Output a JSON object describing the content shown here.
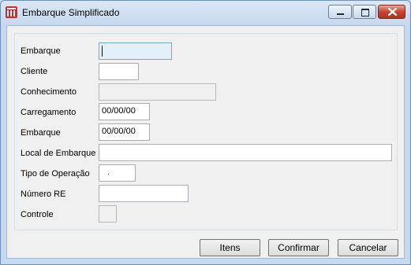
{
  "window": {
    "title": "Embarque Simplificado"
  },
  "form": {
    "embarque_label": "Embarque",
    "cliente_label": "Cliente",
    "conhecimento_label": "Conhecimento",
    "carregamento_label": "Carregamento",
    "carregamento_value": "00/00/00",
    "embarque_data_label": "Embarque",
    "embarque_data_value": "00/00/00",
    "local_label": "Local de Embarque",
    "tipo_label": "Tipo de Operação",
    "tipo_value": ".",
    "numero_re_label": "Número RE",
    "controle_label": "Controle"
  },
  "buttons": {
    "itens": "Itens",
    "confirmar": "Confirmar",
    "cancelar": "Cancelar"
  },
  "colors": {
    "titlebar": "#c7d9ee",
    "close_button": "#c5452d",
    "app_icon": "#d12a2a"
  }
}
